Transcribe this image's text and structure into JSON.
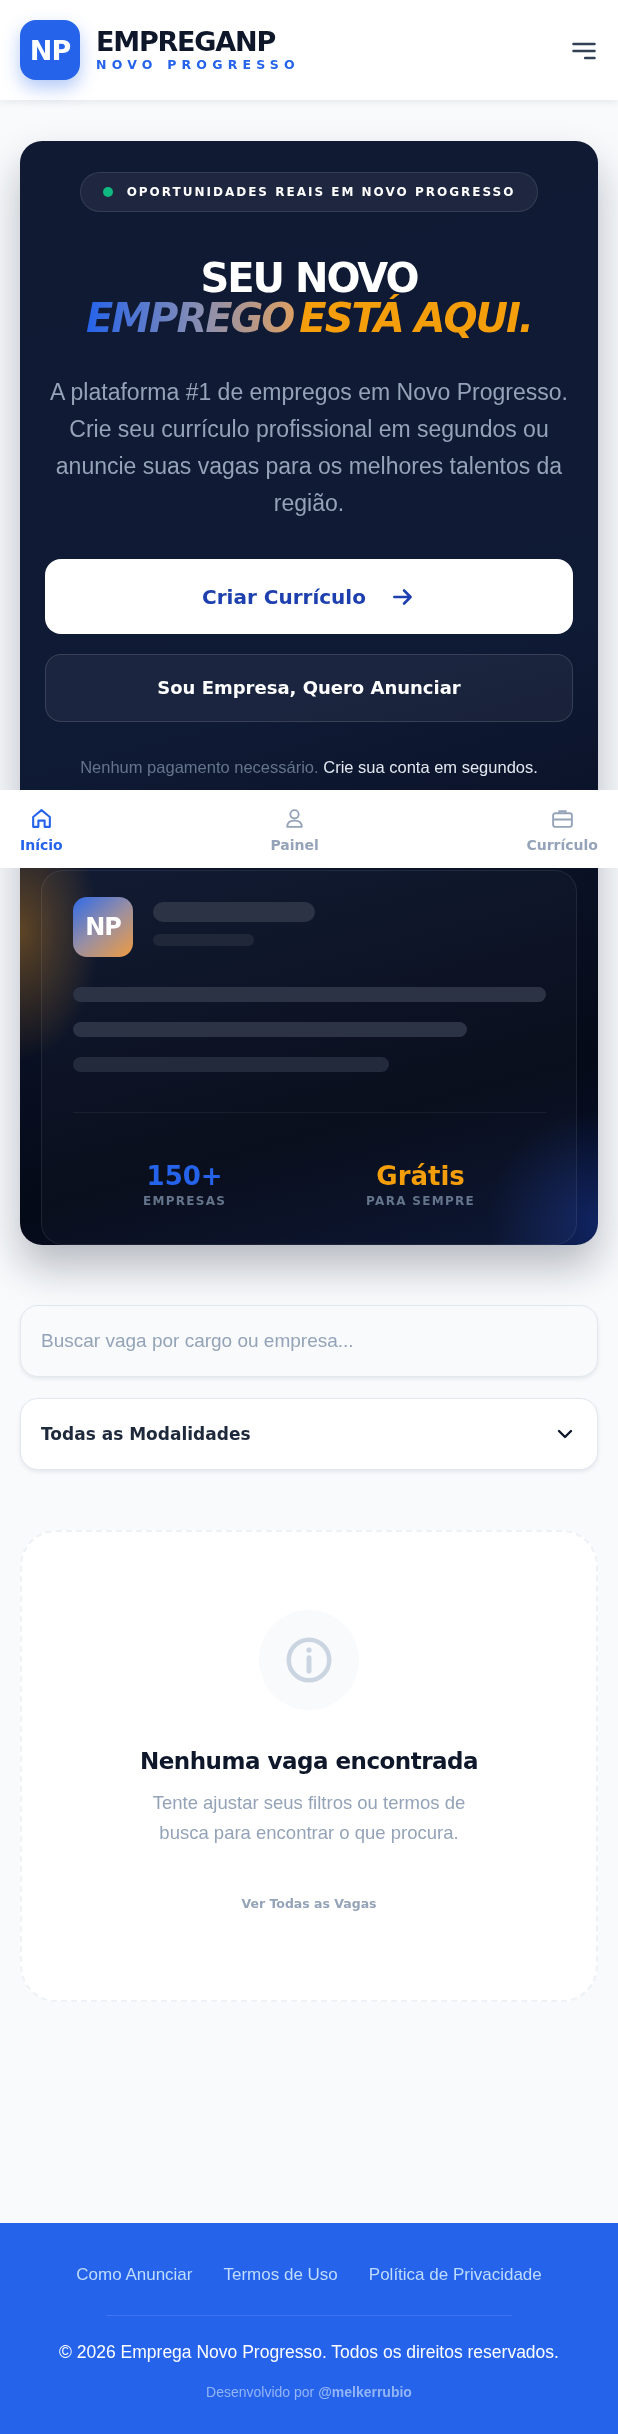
{
  "header": {
    "logo": "NP",
    "brand": "EMPREGANP",
    "tagline": "NOVO PROGRESSO"
  },
  "hero": {
    "badge": "OPORTUNIDADES REAIS EM NOVO PROGRESSO",
    "title_line1": "SEU NOVO",
    "title_highlight": "EMPREGO",
    "title_accent": "ESTÁ AQUI.",
    "description": "A plataforma #1 de empregos em Novo Progresso. Crie seu currículo profissional em segundos ou anuncie suas vagas para os melhores talentos da região.",
    "buttons": [
      {
        "label": "Criar Currículo",
        "kind": "primary"
      },
      {
        "label": "Sou Empresa, Quero Anunciar",
        "kind": "secondary"
      }
    ],
    "note_muted": "Nenhum pagamento necessário.",
    "note_strong": "Crie sua conta em segundos.",
    "preview": {
      "logo": "NP",
      "stats": [
        {
          "value": "150+",
          "label": "EMPRESAS",
          "color": "#2563eb"
        },
        {
          "value": "Grátis",
          "label": "PARA SEMPRE",
          "color": "#f59e0b"
        }
      ]
    }
  },
  "bottom_nav": [
    {
      "label": "Início",
      "kind": "home",
      "selected": true
    },
    {
      "label": "Painel",
      "kind": "user",
      "selected": false
    },
    {
      "label": "Currículo",
      "kind": "briefcase",
      "selected": false
    }
  ],
  "search": {
    "placeholder": "Buscar vaga por cargo ou empresa..."
  },
  "filter": {
    "value": "Todas as Modalidades"
  },
  "empty_state": {
    "title": "Nenhuma vaga encontrada",
    "message": "Tente ajustar seus filtros ou termos de busca para encontrar o que procura.",
    "link": "Ver Todas as Vagas"
  },
  "footer": {
    "links": [
      "Como Anunciar",
      "Termos de Uso",
      "Política de Privacidade"
    ],
    "copyright": "© 2026 Emprega Novo Progresso. Todos os direitos reservados.",
    "credit": "Desenvolvido por **@melkerrubio**"
  }
}
